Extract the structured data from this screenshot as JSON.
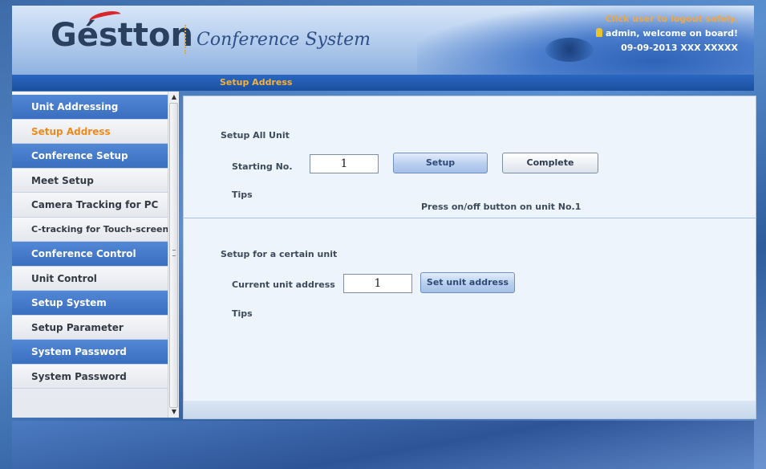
{
  "header": {
    "logo_text": "Géstton",
    "subtitle": "Conference System",
    "logout_hint": "Click user to logout safely.",
    "welcome": "admin, welcome on board!",
    "datetime": "09-09-2013 XXX XXXXX"
  },
  "titlebar": {
    "label": "Setup Address"
  },
  "sidebar": {
    "items": [
      {
        "label": "Unit Addressing"
      },
      {
        "label": "Setup Address"
      },
      {
        "label": "Conference Setup"
      },
      {
        "label": "Meet Setup"
      },
      {
        "label": "Camera Tracking for PC"
      },
      {
        "label": "C-tracking for Touch-screen"
      },
      {
        "label": "Conference Control"
      },
      {
        "label": "Unit Control"
      },
      {
        "label": "Setup System"
      },
      {
        "label": "Setup Parameter"
      },
      {
        "label": "System Password"
      },
      {
        "label": "System Password"
      }
    ]
  },
  "all_unit": {
    "heading": "Setup All Unit",
    "starting_label": "Starting No.",
    "starting_value": "1",
    "setup_button": "Setup",
    "complete_button": "Complete",
    "tips_label": "Tips",
    "tips_message": "Press on/off button on unit No.1"
  },
  "certain_unit": {
    "heading": "Setup for a certain unit",
    "current_label": "Current unit address",
    "current_value": "1",
    "set_button": "Set unit address",
    "tips_label": "Tips"
  },
  "colors": {
    "accent_orange": "#ee8a1d",
    "menu_group_blue": "#3a6ec0",
    "titlebar_blue": "#1a4f9f"
  }
}
